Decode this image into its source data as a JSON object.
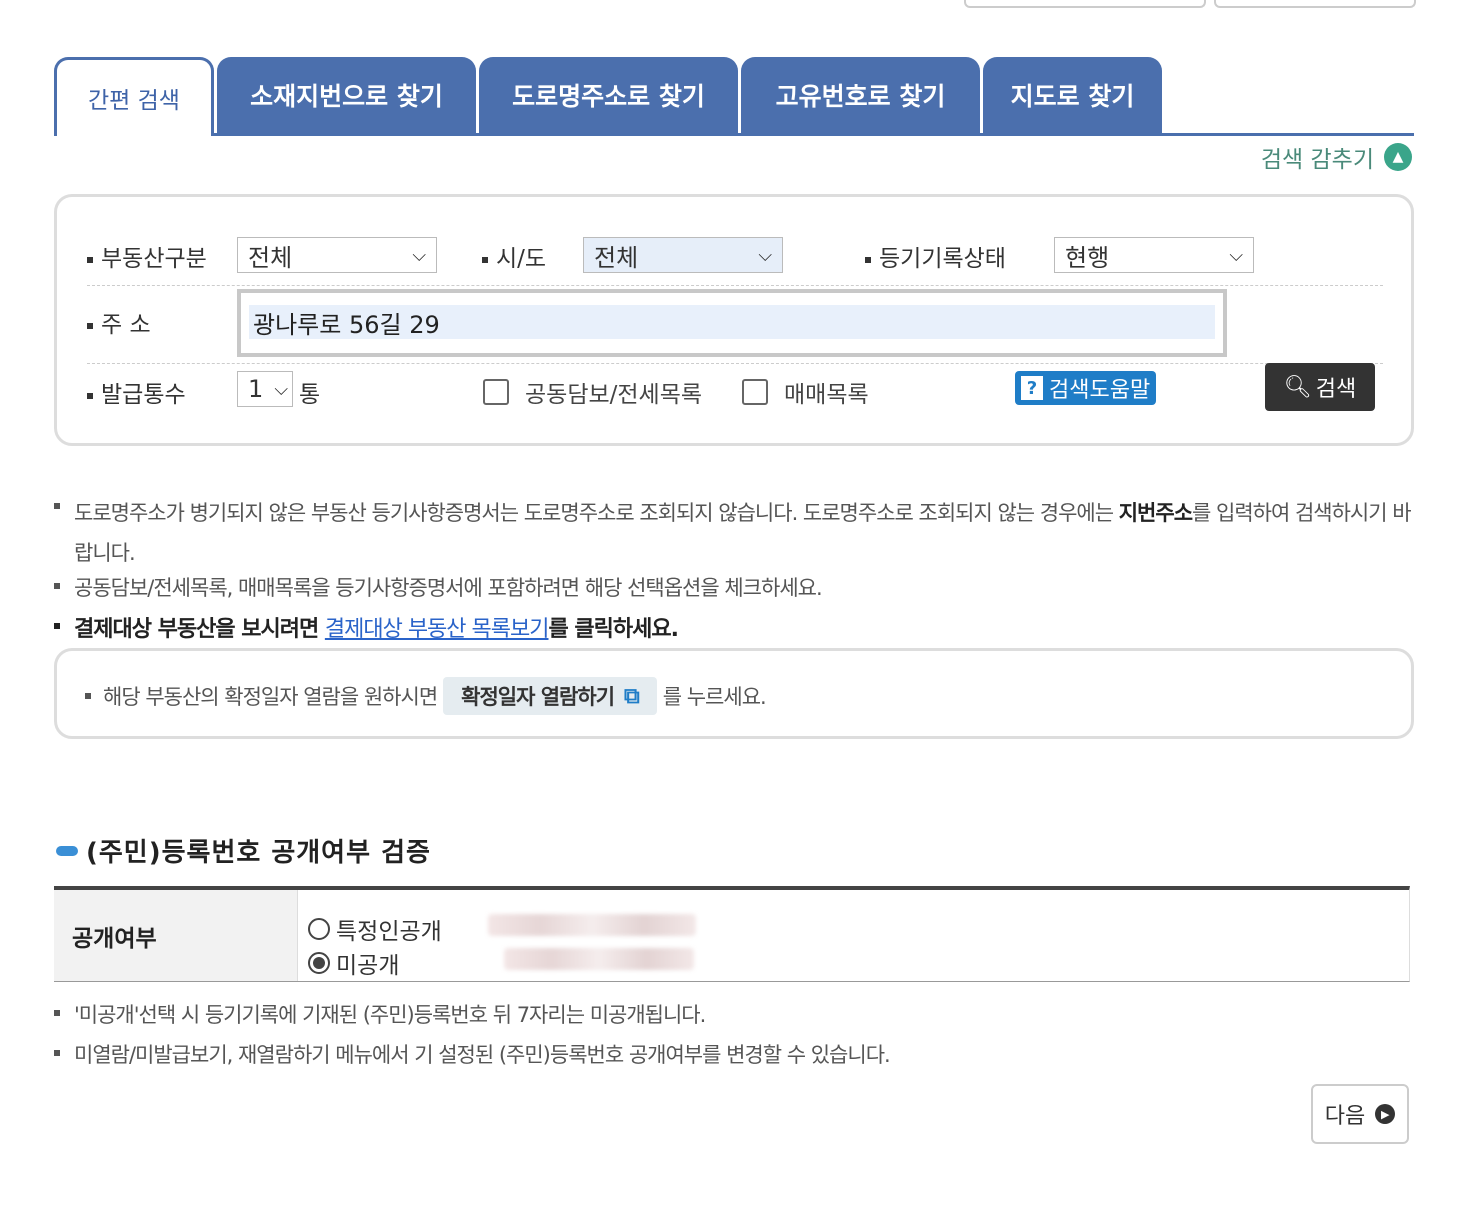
{
  "tabs": [
    {
      "label": "간편 검색"
    },
    {
      "label": "소재지번으로 찾기"
    },
    {
      "label": "도로명주소로 찾기"
    },
    {
      "label": "고유번호로 찾기"
    },
    {
      "label": "지도로 찾기"
    }
  ],
  "toggle_search_label": "검색 감추기",
  "form": {
    "property_type_label": "부동산구분",
    "property_type_value": "전체",
    "sido_label": "시/도",
    "sido_value": "전체",
    "record_status_label": "등기기록상태",
    "record_status_value": "현행",
    "address_label": "주 소",
    "address_value": "광나루로 56길 29",
    "copies_label": "발급통수",
    "copies_value": "1",
    "copies_unit": "통",
    "joint_collateral_label": "공동담보/전세목록",
    "sales_list_label": "매매목록",
    "help_label": "검색도움말",
    "search_label": "검색"
  },
  "notes": {
    "n1_part1": "도로명주소가 병기되지 않은 부동산 등기사항증명서는 도로명주소로 조회되지 않습니다. 도로명주소로 조회되지 않는 경우에는 ",
    "n1_bold": "지번주소",
    "n1_part2": "를 입력하여 검색하시기 바랍니다.",
    "n2": "공동담보/전세목록, 매매목록을 등기사항증명서에 포함하려면 해당 선택옵션을 체크하세요.",
    "n3_part1": "결제대상 부동산을 보시려면 ",
    "n3_link": "결제대상 부동산 목록보기",
    "n3_part2": "를 클릭하세요."
  },
  "confirm_box": {
    "prefix": "해당 부동산의 확정일자 열람을 원하시면",
    "button_label": "확정일자 열람하기",
    "suffix": "를 누르세요."
  },
  "disclosure": {
    "section_title": "(주민)등록번호 공개여부 검증",
    "header": "공개여부",
    "option_specific": "특정인공개",
    "option_private": "미공개",
    "selected": "미공개",
    "note1": "'미공개'선택 시 등기기록에 기재된 (주민)등록번호 뒤 7자리는 미공개됩니다.",
    "note2": "미열람/미발급보기, 재열람하기 메뉴에서 기 설정된 (주민)등록번호 공개여부를 변경할 수 있습니다."
  },
  "next_label": "다음",
  "colors": {
    "tab": "#4b6fad",
    "accent": "#1f7dc7",
    "toggle": "#3aa58a"
  }
}
